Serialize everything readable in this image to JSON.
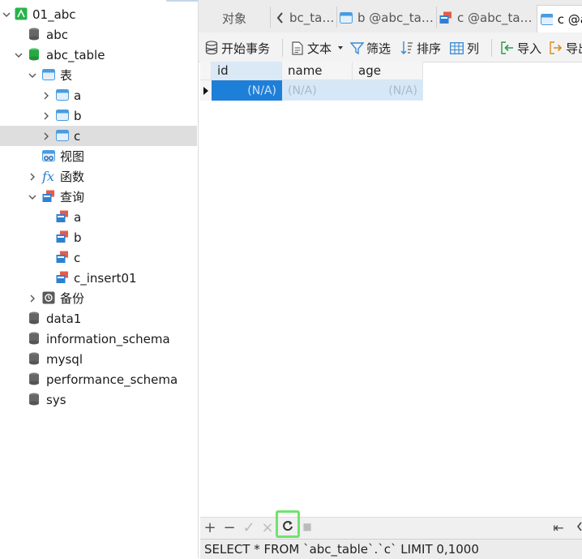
{
  "sidebar": {
    "items": [
      {
        "label": "01_abc",
        "icon": "connection-icon"
      },
      {
        "label": "abc",
        "icon": "database-icon"
      },
      {
        "label": "abc_table",
        "icon": "database-open-icon"
      },
      {
        "label": "表",
        "icon": "tables-folder-icon"
      },
      {
        "label": "a",
        "icon": "table-icon"
      },
      {
        "label": "b",
        "icon": "table-icon"
      },
      {
        "label": "c",
        "icon": "table-icon"
      },
      {
        "label": "视图",
        "icon": "views-icon"
      },
      {
        "label": "函数",
        "icon": "function-icon"
      },
      {
        "label": "查询",
        "icon": "query-folder-icon"
      },
      {
        "label": "a",
        "icon": "query-icon"
      },
      {
        "label": "b",
        "icon": "query-icon"
      },
      {
        "label": "c",
        "icon": "query-icon"
      },
      {
        "label": "c_insert01",
        "icon": "query-icon"
      },
      {
        "label": "备份",
        "icon": "backup-icon"
      },
      {
        "label": "data1",
        "icon": "database-icon"
      },
      {
        "label": "information_schema",
        "icon": "database-icon"
      },
      {
        "label": "mysql",
        "icon": "database-icon"
      },
      {
        "label": "performance_schema",
        "icon": "database-icon"
      },
      {
        "label": "sys",
        "icon": "database-icon"
      }
    ]
  },
  "tabs": {
    "objects": "对象",
    "tab1": "bc_ta…",
    "tab2": "b @abc_ta…",
    "tab3": "c @abc_ta…",
    "tab4": "c @a"
  },
  "toolbar": {
    "begin_transaction": "开始事务",
    "text": "文本",
    "filter": "筛选",
    "sort": "排序",
    "columns": "列",
    "import": "导入",
    "export": "导出"
  },
  "grid": {
    "columns": [
      "id",
      "name",
      "age"
    ],
    "row": [
      "(N/A)",
      "(N/A)",
      "(N/A)"
    ]
  },
  "bottom": {
    "add": "+",
    "remove": "−",
    "apply": "✓",
    "discard": "×",
    "refresh": "c",
    "stop": "■",
    "first": "⇤"
  },
  "status": {
    "sql": "SELECT * FROM `abc_table`.`c` LIMIT 0,1000"
  },
  "colors": {
    "selection_blue": "#1e7fd9",
    "row_blue": "#d6e8f8",
    "highlight_green": "#6fe36f"
  }
}
